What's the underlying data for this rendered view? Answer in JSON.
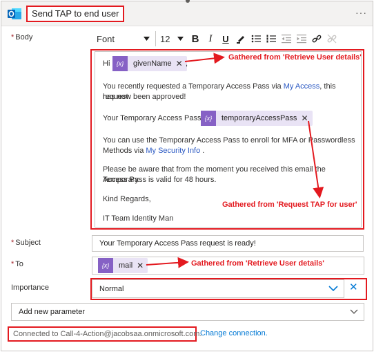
{
  "header": {
    "title": "Send TAP to end user",
    "more_label": "···"
  },
  "labels": {
    "body": "Body",
    "subject": "Subject",
    "to": "To",
    "importance": "Importance",
    "required_mark": "*"
  },
  "toolbar": {
    "font": "Font",
    "size": "12",
    "bold": "B",
    "italic": "I",
    "underline": "U"
  },
  "body": {
    "greeting": "Hi",
    "greeting_suffix": ",",
    "token_given_name": "givenName",
    "line1a": "You recently requested a Temporary Access Pass via ",
    "line1_link": "My Access",
    "line1b": ", this request",
    "line2": "has now been approved!",
    "tap_prefix": "Your Temporary Access Pass is:",
    "token_tap": "temporaryAccessPass",
    "line3": "You can use the Temporary Access Pass to enroll for MFA or Passwordless",
    "line4a": "Methods via ",
    "line4_link": "My Security Info",
    "line4b": " .",
    "line5": "Please be aware that from the moment you received this email the Temporary",
    "line6": "Access Pass is valid for 48 hours.",
    "line7": "Kind Regards,",
    "line8": "IT Team Identity Man"
  },
  "subject": {
    "value": "Your Temporary Access Pass request is ready!"
  },
  "to": {
    "token": "mail"
  },
  "importance": {
    "value": "Normal"
  },
  "add_parameter": "Add new parameter",
  "connection": {
    "text": "Connected to Call-4-Action@jacobsaa.onmicrosoft.com.",
    "change": "Change connection."
  },
  "annotations": {
    "retrieve_user_1": "Gathered from 'Retrieve User details'",
    "request_tap": "Gathered from 'Request TAP for user'",
    "retrieve_user_2": "Gathered from 'Retrieve User details'"
  },
  "token_icon_glyph": "{x}",
  "colors": {
    "annotation_red": "#e3191f",
    "token_bg": "#e9e3f5",
    "token_icon": "#8661c5",
    "link": "#0078d4"
  }
}
